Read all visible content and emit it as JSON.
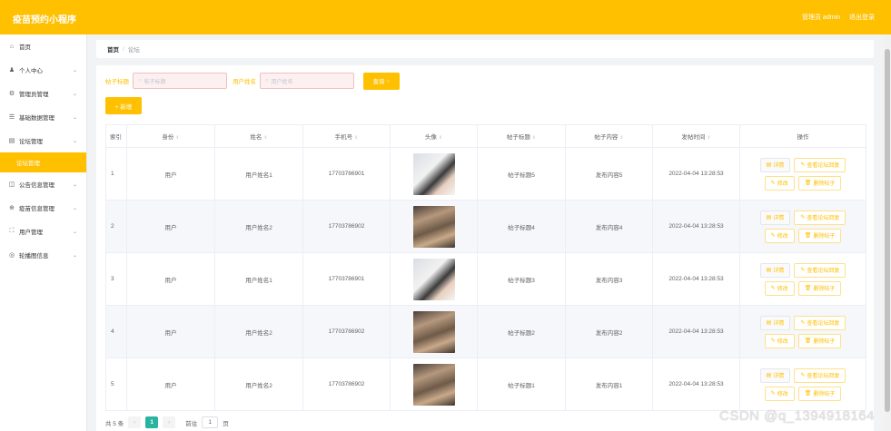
{
  "header": {
    "title": "疫苗预约小程序",
    "user_label": "管理员 admin",
    "logout": "退出登录"
  },
  "sidebar": {
    "items": [
      {
        "icon": "home-icon",
        "glyph": "⌂",
        "label": "首页",
        "chevron": false
      },
      {
        "icon": "user-icon",
        "glyph": "♟",
        "label": "个人中心",
        "chevron": true
      },
      {
        "icon": "admin-icon",
        "glyph": "⚙",
        "label": "管理员管理",
        "chevron": true
      },
      {
        "icon": "data-icon",
        "glyph": "☰",
        "label": "基础数据管理",
        "chevron": true
      },
      {
        "icon": "forum-icon",
        "glyph": "▤",
        "label": "论坛管理",
        "chevron": true,
        "sub": "论坛管理"
      },
      {
        "icon": "notice-icon",
        "glyph": "◫",
        "label": "公告信息管理",
        "chevron": true
      },
      {
        "icon": "vaccine-icon",
        "glyph": "⊕",
        "label": "疫苗信息管理",
        "chevron": true
      },
      {
        "icon": "users-icon",
        "glyph": "⛶",
        "label": "用户管理",
        "chevron": true
      },
      {
        "icon": "carousel-icon",
        "glyph": "◎",
        "label": "轮播图信息",
        "chevron": true
      }
    ]
  },
  "breadcrumb": {
    "home": "首页",
    "current": "论坛"
  },
  "search": {
    "title_label": "帖子标题",
    "title_placeholder": "帖子标题",
    "name_label": "用户姓名",
    "name_placeholder": "用户姓名",
    "search_btn": "查询",
    "add_btn": "+ 新增"
  },
  "table": {
    "headers": [
      "索引",
      "身份",
      "姓名",
      "手机号",
      "头像",
      "帖子标题",
      "帖子内容",
      "发帖时间",
      "操作"
    ],
    "rows": [
      {
        "idx": "1",
        "role": "用户",
        "name": "用户姓名1",
        "phone": "17703786901",
        "avatar": "a1",
        "title": "帖子标题5",
        "content": "发布内容5",
        "time": "2022-04-04 13:28:53"
      },
      {
        "idx": "2",
        "role": "用户",
        "name": "用户姓名2",
        "phone": "17703786902",
        "avatar": "a2",
        "title": "帖子标题4",
        "content": "发布内容4",
        "time": "2022-04-04 13:28:53"
      },
      {
        "idx": "3",
        "role": "用户",
        "name": "用户姓名1",
        "phone": "17703786901",
        "avatar": "a1",
        "title": "帖子标题3",
        "content": "发布内容3",
        "time": "2022-04-04 13:28:53"
      },
      {
        "idx": "4",
        "role": "用户",
        "name": "用户姓名2",
        "phone": "17703786902",
        "avatar": "a2",
        "title": "帖子标题2",
        "content": "发布内容2",
        "time": "2022-04-04 13:28:53"
      },
      {
        "idx": "5",
        "role": "用户",
        "name": "用户姓名2",
        "phone": "17703786902",
        "avatar": "a2",
        "title": "帖子标题1",
        "content": "发布内容1",
        "time": "2022-04-04 13:28:53"
      }
    ],
    "ops": {
      "detail": "详情",
      "view_reply": "查看论坛回复",
      "edit": "修改",
      "delete": "删除帖子"
    }
  },
  "pager": {
    "total": "共 5 条",
    "prev": "‹",
    "page": "1",
    "next": "›",
    "goto": "前往",
    "goto_value": "1",
    "unit": "页"
  },
  "watermark": "CSDN @q_1394918164",
  "colors": {
    "accent": "#ffc000",
    "pager_active": "#28b4a0"
  }
}
